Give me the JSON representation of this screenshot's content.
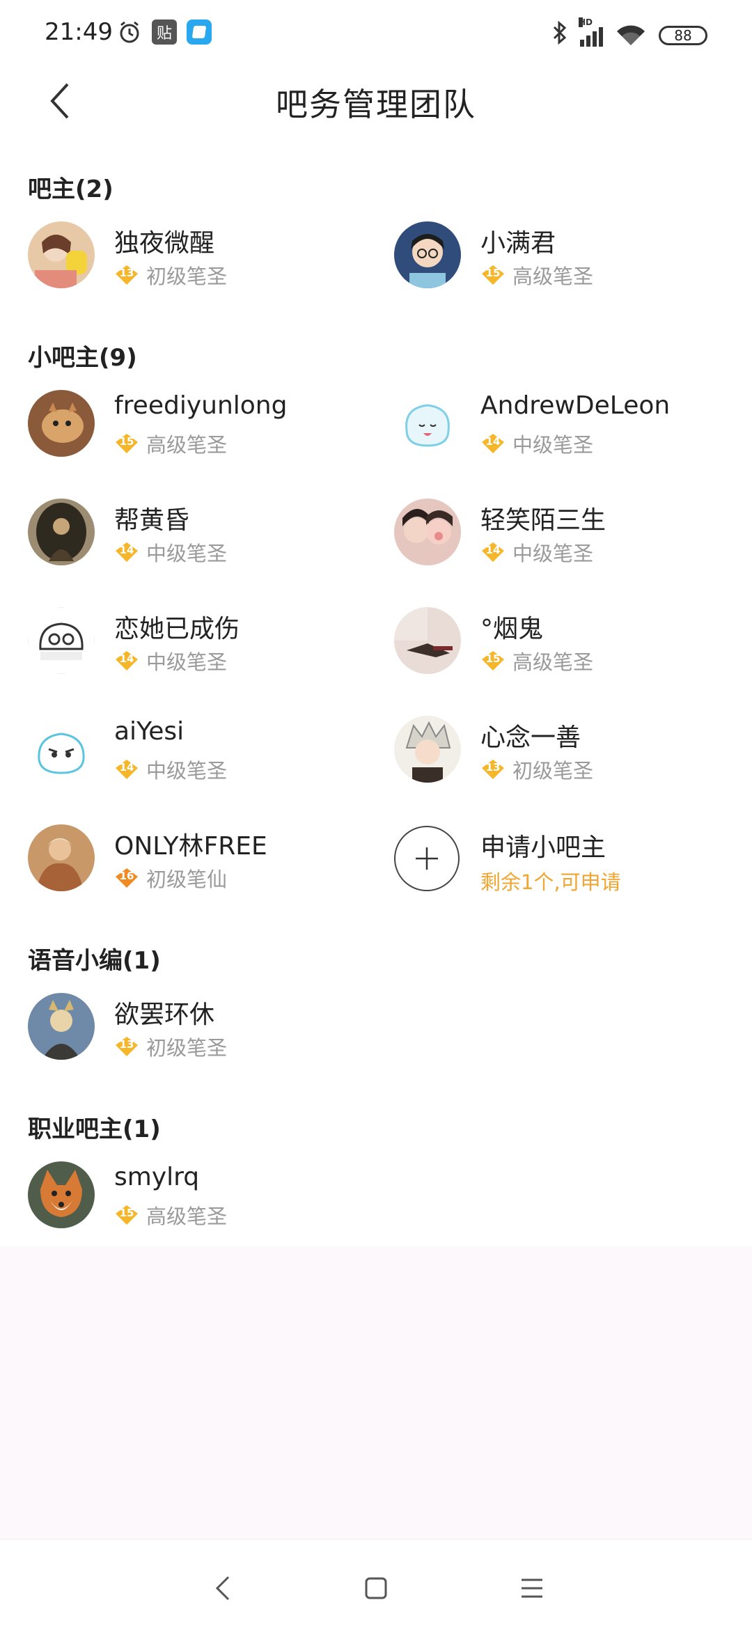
{
  "status_bar": {
    "time": "21:49",
    "tie_label": "贴",
    "hd": "HD",
    "battery": "88"
  },
  "header": {
    "title": "吧务管理团队"
  },
  "sections": [
    {
      "title": "吧主(2)"
    },
    {
      "title": "小吧主(9)"
    },
    {
      "title": "语音小编(1)"
    },
    {
      "title": "职业吧主(1)"
    }
  ],
  "owners": [
    {
      "name": "独夜微醒",
      "level": "13",
      "title": "初级笔圣",
      "badge_color": "#f5b62a"
    },
    {
      "name": "小满君",
      "level": "15",
      "title": "高级笔圣",
      "badge_color": "#f5b62a"
    }
  ],
  "sub_owners": [
    {
      "name": "freediyunlong",
      "level": "15",
      "title": "高级笔圣",
      "badge_color": "#f5b62a"
    },
    {
      "name": "AndrewDeLeon",
      "level": "14",
      "title": "中级笔圣",
      "badge_color": "#f5b62a"
    },
    {
      "name": "帮黄昏",
      "level": "14",
      "title": "中级笔圣",
      "badge_color": "#f5b62a"
    },
    {
      "name": "轻笑陌三生",
      "level": "14",
      "title": "中级笔圣",
      "badge_color": "#f5b62a"
    },
    {
      "name": "恋她已成伤",
      "level": "14",
      "title": "中级笔圣",
      "badge_color": "#f5b62a"
    },
    {
      "name": "°烟鬼",
      "level": "15",
      "title": "高级笔圣",
      "badge_color": "#f5b62a"
    },
    {
      "name": "aiYesi",
      "level": "14",
      "title": "中级笔圣",
      "badge_color": "#f5b62a"
    },
    {
      "name": "心念一善",
      "level": "13",
      "title": "初级笔圣",
      "badge_color": "#f5b62a"
    },
    {
      "name": "ONLY林FREE",
      "level": "16",
      "title": "初级笔仙",
      "badge_color": "#f08a22"
    }
  ],
  "apply": {
    "label": "申请小吧主",
    "sub": "剩余1个,可申请"
  },
  "voice_editors": [
    {
      "name": "欲罢环休",
      "level": "13",
      "title": "初级笔圣",
      "badge_color": "#f5b62a"
    }
  ],
  "pro_owners": [
    {
      "name": "smylrq",
      "level": "15",
      "title": "高级笔圣",
      "badge_color": "#f5b62a"
    }
  ],
  "colors": {
    "accent": "#f0a630",
    "badge": "#f5b62a",
    "badge_xian": "#f08a22"
  }
}
